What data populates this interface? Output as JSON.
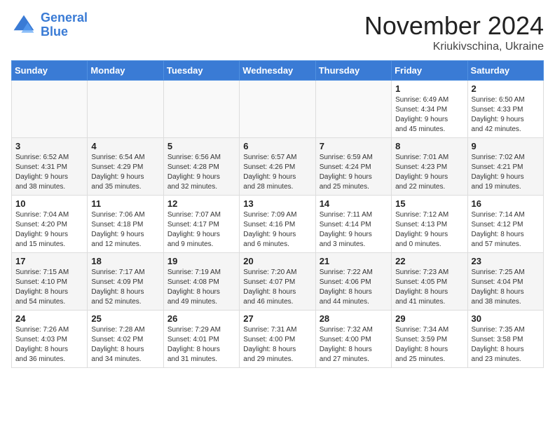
{
  "logo": {
    "line1": "General",
    "line2": "Blue"
  },
  "title": "November 2024",
  "location": "Kriukivschina, Ukraine",
  "weekdays": [
    "Sunday",
    "Monday",
    "Tuesday",
    "Wednesday",
    "Thursday",
    "Friday",
    "Saturday"
  ],
  "weeks": [
    [
      {
        "day": "",
        "info": ""
      },
      {
        "day": "",
        "info": ""
      },
      {
        "day": "",
        "info": ""
      },
      {
        "day": "",
        "info": ""
      },
      {
        "day": "",
        "info": ""
      },
      {
        "day": "1",
        "info": "Sunrise: 6:49 AM\nSunset: 4:34 PM\nDaylight: 9 hours\nand 45 minutes."
      },
      {
        "day": "2",
        "info": "Sunrise: 6:50 AM\nSunset: 4:33 PM\nDaylight: 9 hours\nand 42 minutes."
      }
    ],
    [
      {
        "day": "3",
        "info": "Sunrise: 6:52 AM\nSunset: 4:31 PM\nDaylight: 9 hours\nand 38 minutes."
      },
      {
        "day": "4",
        "info": "Sunrise: 6:54 AM\nSunset: 4:29 PM\nDaylight: 9 hours\nand 35 minutes."
      },
      {
        "day": "5",
        "info": "Sunrise: 6:56 AM\nSunset: 4:28 PM\nDaylight: 9 hours\nand 32 minutes."
      },
      {
        "day": "6",
        "info": "Sunrise: 6:57 AM\nSunset: 4:26 PM\nDaylight: 9 hours\nand 28 minutes."
      },
      {
        "day": "7",
        "info": "Sunrise: 6:59 AM\nSunset: 4:24 PM\nDaylight: 9 hours\nand 25 minutes."
      },
      {
        "day": "8",
        "info": "Sunrise: 7:01 AM\nSunset: 4:23 PM\nDaylight: 9 hours\nand 22 minutes."
      },
      {
        "day": "9",
        "info": "Sunrise: 7:02 AM\nSunset: 4:21 PM\nDaylight: 9 hours\nand 19 minutes."
      }
    ],
    [
      {
        "day": "10",
        "info": "Sunrise: 7:04 AM\nSunset: 4:20 PM\nDaylight: 9 hours\nand 15 minutes."
      },
      {
        "day": "11",
        "info": "Sunrise: 7:06 AM\nSunset: 4:18 PM\nDaylight: 9 hours\nand 12 minutes."
      },
      {
        "day": "12",
        "info": "Sunrise: 7:07 AM\nSunset: 4:17 PM\nDaylight: 9 hours\nand 9 minutes."
      },
      {
        "day": "13",
        "info": "Sunrise: 7:09 AM\nSunset: 4:16 PM\nDaylight: 9 hours\nand 6 minutes."
      },
      {
        "day": "14",
        "info": "Sunrise: 7:11 AM\nSunset: 4:14 PM\nDaylight: 9 hours\nand 3 minutes."
      },
      {
        "day": "15",
        "info": "Sunrise: 7:12 AM\nSunset: 4:13 PM\nDaylight: 9 hours\nand 0 minutes."
      },
      {
        "day": "16",
        "info": "Sunrise: 7:14 AM\nSunset: 4:12 PM\nDaylight: 8 hours\nand 57 minutes."
      }
    ],
    [
      {
        "day": "17",
        "info": "Sunrise: 7:15 AM\nSunset: 4:10 PM\nDaylight: 8 hours\nand 54 minutes."
      },
      {
        "day": "18",
        "info": "Sunrise: 7:17 AM\nSunset: 4:09 PM\nDaylight: 8 hours\nand 52 minutes."
      },
      {
        "day": "19",
        "info": "Sunrise: 7:19 AM\nSunset: 4:08 PM\nDaylight: 8 hours\nand 49 minutes."
      },
      {
        "day": "20",
        "info": "Sunrise: 7:20 AM\nSunset: 4:07 PM\nDaylight: 8 hours\nand 46 minutes."
      },
      {
        "day": "21",
        "info": "Sunrise: 7:22 AM\nSunset: 4:06 PM\nDaylight: 8 hours\nand 44 minutes."
      },
      {
        "day": "22",
        "info": "Sunrise: 7:23 AM\nSunset: 4:05 PM\nDaylight: 8 hours\nand 41 minutes."
      },
      {
        "day": "23",
        "info": "Sunrise: 7:25 AM\nSunset: 4:04 PM\nDaylight: 8 hours\nand 38 minutes."
      }
    ],
    [
      {
        "day": "24",
        "info": "Sunrise: 7:26 AM\nSunset: 4:03 PM\nDaylight: 8 hours\nand 36 minutes."
      },
      {
        "day": "25",
        "info": "Sunrise: 7:28 AM\nSunset: 4:02 PM\nDaylight: 8 hours\nand 34 minutes."
      },
      {
        "day": "26",
        "info": "Sunrise: 7:29 AM\nSunset: 4:01 PM\nDaylight: 8 hours\nand 31 minutes."
      },
      {
        "day": "27",
        "info": "Sunrise: 7:31 AM\nSunset: 4:00 PM\nDaylight: 8 hours\nand 29 minutes."
      },
      {
        "day": "28",
        "info": "Sunrise: 7:32 AM\nSunset: 4:00 PM\nDaylight: 8 hours\nand 27 minutes."
      },
      {
        "day": "29",
        "info": "Sunrise: 7:34 AM\nSunset: 3:59 PM\nDaylight: 8 hours\nand 25 minutes."
      },
      {
        "day": "30",
        "info": "Sunrise: 7:35 AM\nSunset: 3:58 PM\nDaylight: 8 hours\nand 23 minutes."
      }
    ]
  ]
}
